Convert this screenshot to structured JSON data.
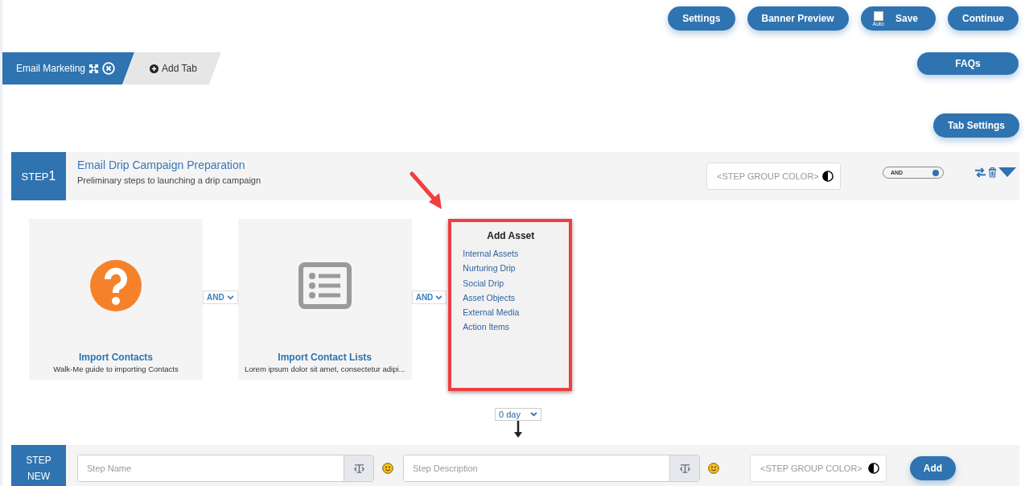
{
  "header_buttons": [
    {
      "kind": "plain",
      "label": "Settings"
    },
    {
      "kind": "plain",
      "label": "Banner Preview"
    },
    {
      "kind": "save",
      "label": "Save",
      "auto_label": "Auto",
      "checked": false
    },
    {
      "kind": "plain",
      "label": "Continue"
    }
  ],
  "tabs": [
    {
      "label": "Email Marketing",
      "selected": true
    },
    {
      "label": "Add Tab",
      "selected": false
    }
  ],
  "faqs_button": "FAQs",
  "tab_settings_button": "Tab Settings",
  "step": {
    "prefix": "STEP",
    "number": "1",
    "title": "Email Drip Campaign Preparation",
    "description": "Preliminary steps to launching a drip campaign",
    "color_placeholder": "<STEP GROUP COLOR>",
    "toggle": {
      "label": "AND",
      "on": true
    }
  },
  "cards": [
    {
      "kind": "question",
      "title": "Import Contacts",
      "description": "Walk-Me guide to importing Contacts",
      "connector": "AND"
    },
    {
      "kind": "list",
      "title": "Import Contact Lists",
      "description": "Lorem ipsum dolor sit amet, consectetur adipi...",
      "connector": "AND"
    }
  ],
  "add_asset": {
    "title": "Add Asset",
    "items": [
      "Internal Assets",
      "Nurturing Drip",
      "Social Drip",
      "Asset Objects",
      "External Media",
      "Action Items"
    ]
  },
  "delay": "0 day",
  "new_step": {
    "label_top": "STEP",
    "label_bottom": "NEW",
    "name_placeholder": "Step Name",
    "description_placeholder": "Step Description",
    "color_placeholder": "<STEP GROUP COLOR>",
    "add_button": "Add"
  }
}
